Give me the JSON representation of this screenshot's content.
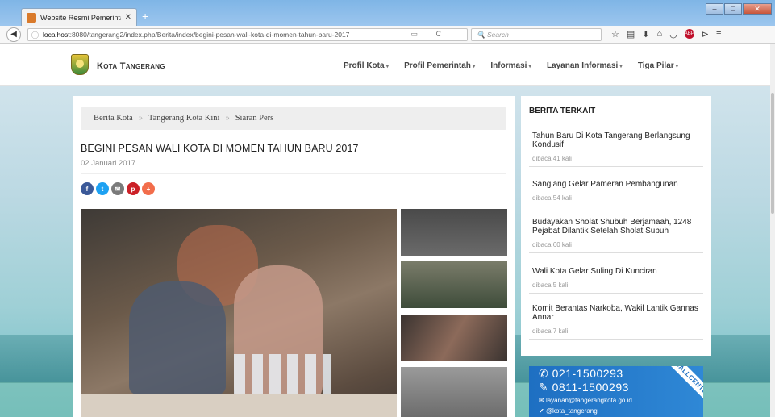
{
  "browser": {
    "tab_title": "Website Resmi Pemerintah K",
    "new_tab_symbol": "+",
    "url_host": "localhost",
    "url_rest": ":8080/tangerang2/index.php/Berita/index/begini-pesan-wali-kota-di-momen-tahun-baru-2017",
    "search_placeholder": "Search",
    "toolbar_icons": [
      "star-icon",
      "clipboard-icon",
      "download-icon",
      "home-icon",
      "pocket-icon",
      "adblock-icon",
      "extension-icon",
      "menu-icon"
    ]
  },
  "site": {
    "name": "Kota Tangerang",
    "nav": [
      {
        "label": "Profil Kota"
      },
      {
        "label": "Profil Pemerintah"
      },
      {
        "label": "Informasi"
      },
      {
        "label": "Layanan Informasi"
      },
      {
        "label": "Tiga Pilar"
      }
    ]
  },
  "article": {
    "breadcrumb": [
      "Berita Kota",
      "Tangerang Kota Kini",
      "Siaran Pers"
    ],
    "title": "BEGINI PESAN WALI KOTA DI MOMEN TAHUN BARU 2017",
    "date": "02 Januari 2017",
    "share_colors": {
      "facebook": "#3b5998",
      "twitter": "#1da1f2",
      "email": "#7a7a7a",
      "pinterest": "#cb2027",
      "more": "#f26d4b"
    }
  },
  "sidebar": {
    "title": "BERITA TERKAIT",
    "items": [
      {
        "title": "Tahun Baru Di Kota Tangerang Berlangsung Kondusif",
        "views": "dibaca 41 kali"
      },
      {
        "title": "Sangiang Gelar Pameran Pembangunan",
        "views": "dibaca 54 kali"
      },
      {
        "title": "Budayakan Sholat Shubuh Berjamaah, 1248 Pejabat Dilantik Setelah Sholat Subuh",
        "views": "dibaca 60 kali"
      },
      {
        "title": "Wali Kota Gelar Suling Di Kunciran",
        "views": "dibaca 5 kali"
      },
      {
        "title": "Komit Berantas Narkoba, Wakil Lantik Gannas Annar",
        "views": "dibaca 7 kali"
      }
    ]
  },
  "callcenter": {
    "phone1": "021-1500293",
    "phone2": "0811-1500293",
    "email": "layanan@tangerangkota.go.id",
    "twitter": "@kota_tangerang",
    "ribbon": "CALLCENTER"
  }
}
